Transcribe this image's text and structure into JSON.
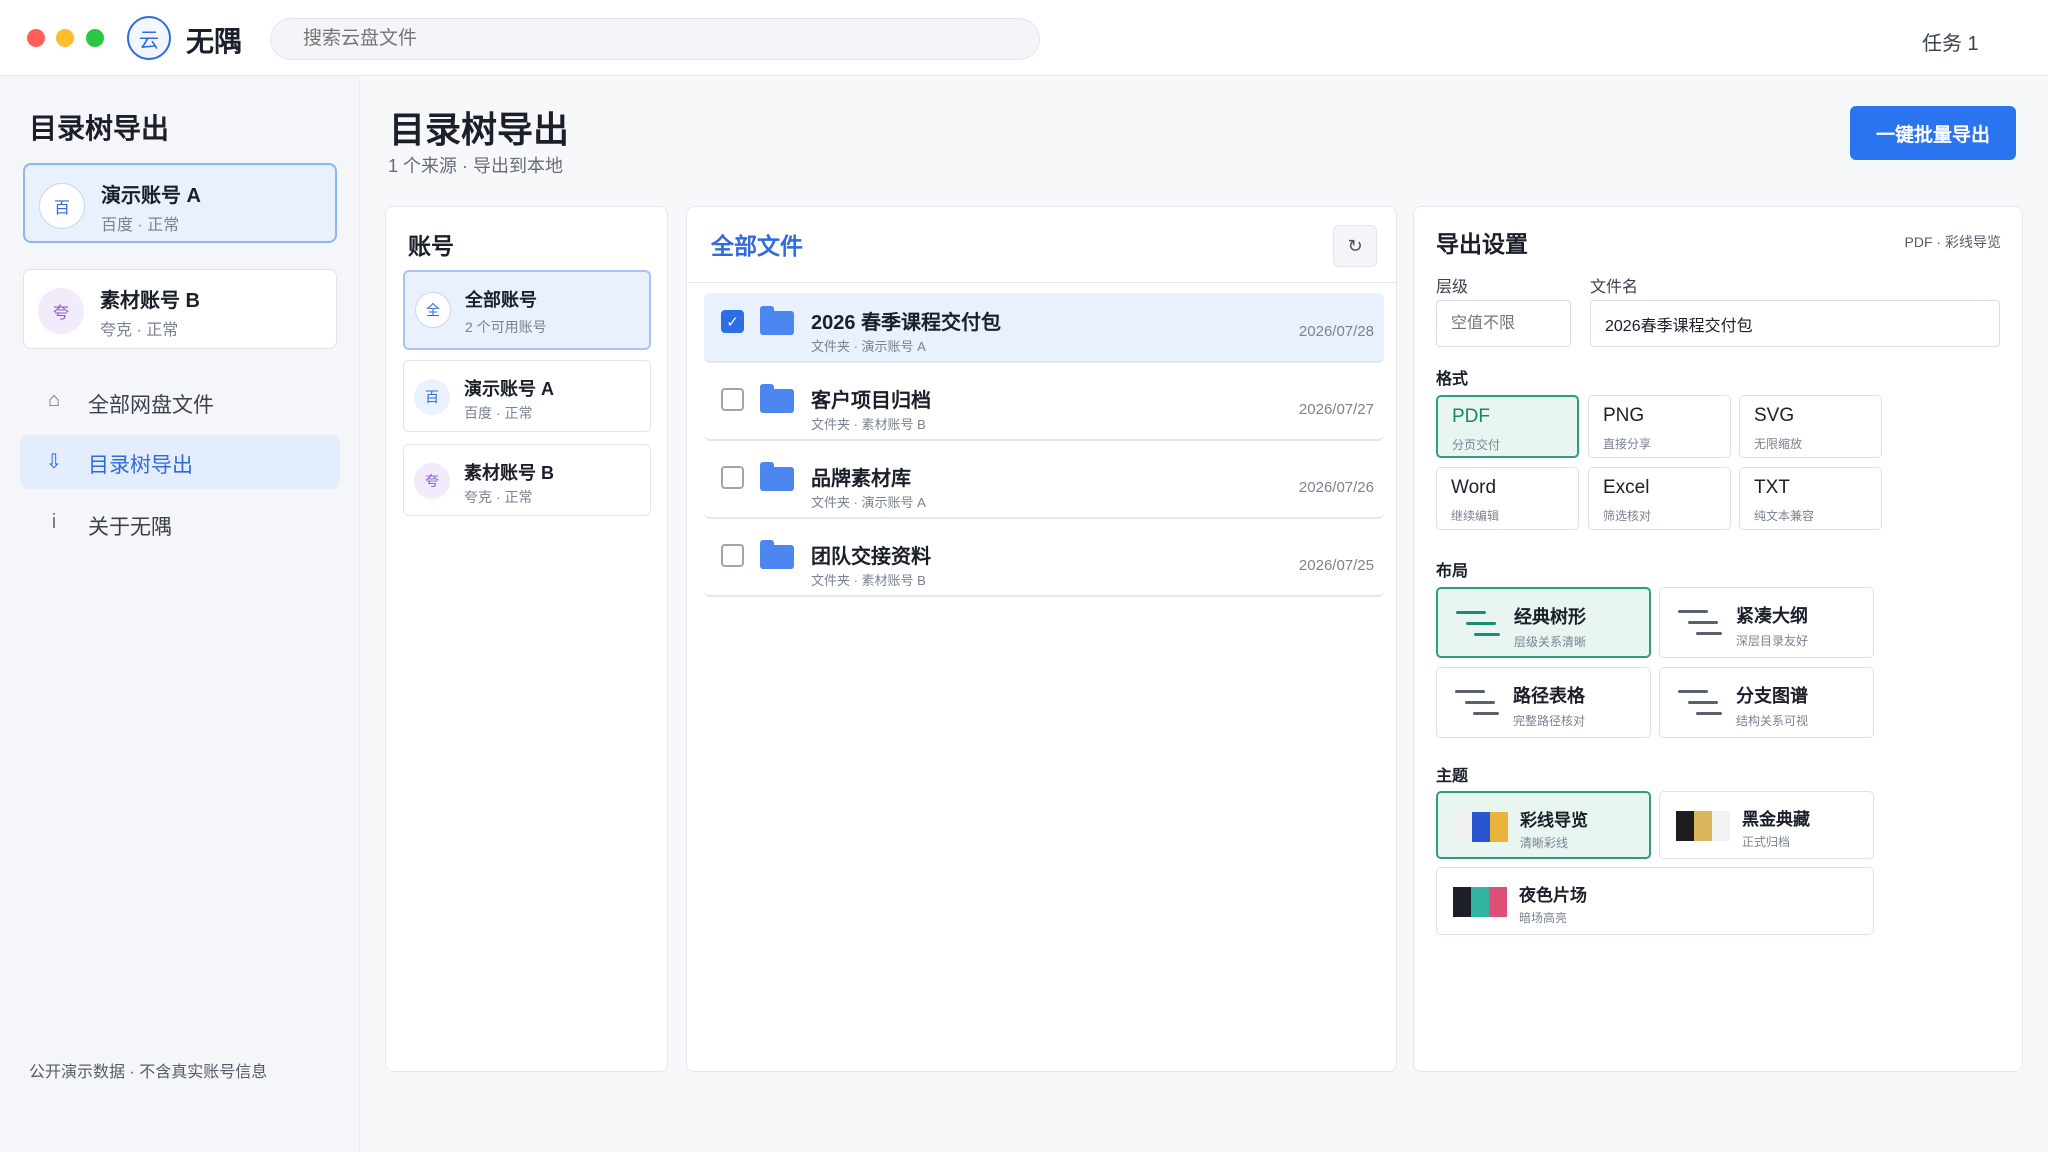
{
  "app": {
    "logo_glyph": "云",
    "name": "无隅",
    "search_placeholder": "搜索云盘文件",
    "tasks": "任务 1"
  },
  "sidebar": {
    "title": "目录树导出",
    "accounts": [
      {
        "avatar": "百",
        "name": "演示账号 A",
        "status": "百度 · 正常",
        "active": true
      },
      {
        "avatar": "夸",
        "name": "素材账号 B",
        "status": "夸克 · 正常",
        "active": false
      }
    ],
    "nav": [
      {
        "icon": "⌂",
        "icon_name": "home-icon",
        "label": "全部网盘文件"
      },
      {
        "icon": "⇩",
        "icon_name": "download-icon",
        "label": "目录树导出",
        "active": true
      },
      {
        "icon": "i",
        "icon_name": "info-icon",
        "label": "关于无隅"
      }
    ],
    "footer": "公开演示数据 · 不含真实账号信息"
  },
  "header": {
    "title": "目录树导出",
    "subtitle": "1 个来源 · 导出到本地",
    "export_button": "一键批量导出"
  },
  "accounts_panel": {
    "title": "账号",
    "items": [
      {
        "avatar": "全",
        "name": "全部账号",
        "status": "2 个可用账号",
        "active": true
      },
      {
        "avatar": "百",
        "name": "演示账号 A",
        "status": "百度 · 正常"
      },
      {
        "avatar": "夸",
        "name": "素材账号 B",
        "status": "夸克 · 正常"
      }
    ]
  },
  "files_panel": {
    "title": "全部文件",
    "refresh_glyph": "↻",
    "files": [
      {
        "name": "2026 春季课程交付包",
        "meta": "文件夹 · 演示账号 A",
        "date": "2026/07/28",
        "checked": true
      },
      {
        "name": "客户项目归档",
        "meta": "文件夹 · 素材账号 B",
        "date": "2026/07/27",
        "checked": false
      },
      {
        "name": "品牌素材库",
        "meta": "文件夹 · 演示账号 A",
        "date": "2026/07/26",
        "checked": false
      },
      {
        "name": "团队交接资料",
        "meta": "文件夹 · 素材账号 B",
        "date": "2026/07/25",
        "checked": false
      }
    ]
  },
  "export_panel": {
    "title": "导出设置",
    "summary": "PDF · 彩线导览",
    "level_label": "层级",
    "level_placeholder": "空值不限",
    "filename_label": "文件名",
    "filename_value": "2026春季课程交付包",
    "format_label": "格式",
    "formats": [
      {
        "name": "PDF",
        "desc": "分页交付",
        "active": true
      },
      {
        "name": "PNG",
        "desc": "直接分享"
      },
      {
        "name": "SVG",
        "desc": "无限缩放"
      },
      {
        "name": "Word",
        "desc": "继续编辑"
      },
      {
        "name": "Excel",
        "desc": "筛选核对"
      },
      {
        "name": "TXT",
        "desc": "纯文本兼容"
      }
    ],
    "layout_label": "布局",
    "layouts": [
      {
        "name": "经典树形",
        "desc": "层级关系清晰",
        "active": true
      },
      {
        "name": "紧凑大纲",
        "desc": "深层目录友好"
      },
      {
        "name": "路径表格",
        "desc": "完整路径核对"
      },
      {
        "name": "分支图谱",
        "desc": "结构关系可视"
      }
    ],
    "theme_label": "主题",
    "themes": [
      {
        "name": "彩线导览",
        "desc": "清晰彩线",
        "colors": [
          "#f1f1f1",
          "#2a55d0",
          "#e9b43a"
        ],
        "active": true
      },
      {
        "name": "黑金典藏",
        "desc": "正式归档",
        "colors": [
          "#1d1d1d",
          "#d9b65c",
          "#f2f2f2"
        ]
      },
      {
        "name": "夜色片场",
        "desc": "暗场高亮",
        "colors": [
          "#1c1f26",
          "#32b4a2",
          "#de4f76"
        ]
      }
    ]
  },
  "colors": {
    "accent": "#2b74f0",
    "selected_green": "#2f9b84",
    "folder": "#4c86f0"
  }
}
